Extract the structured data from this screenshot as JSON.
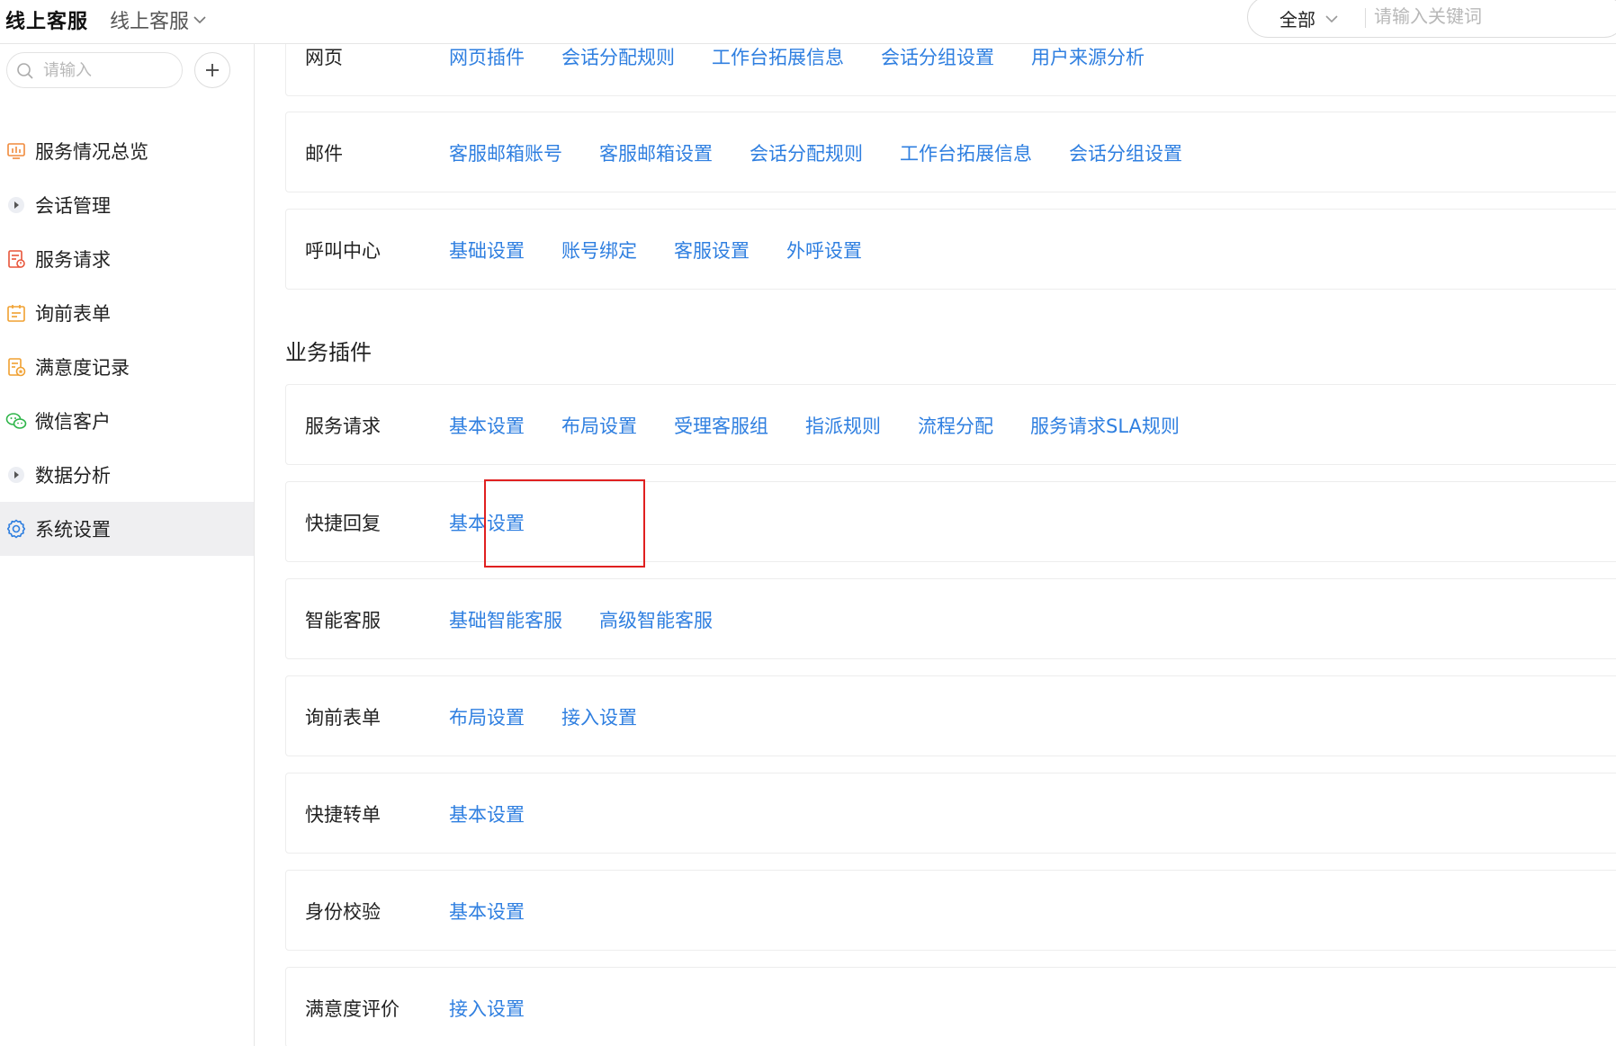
{
  "header": {
    "app_title": "线上客服",
    "app_switcher": "线上客服",
    "search_scope": "全部",
    "search_placeholder": "请输入关键词"
  },
  "sidebar": {
    "search_placeholder": "请输入",
    "items": [
      {
        "label": "服务情况总览",
        "icon": "monitor-chart-icon"
      },
      {
        "label": "会话管理",
        "icon": "caret-right-icon"
      },
      {
        "label": "服务请求",
        "icon": "ticket-icon"
      },
      {
        "label": "询前表单",
        "icon": "form-icon"
      },
      {
        "label": "满意度记录",
        "icon": "rating-record-icon"
      },
      {
        "label": "微信客户",
        "icon": "wechat-icon"
      },
      {
        "label": "数据分析",
        "icon": "caret-right-icon"
      },
      {
        "label": "系统设置",
        "icon": "gear-icon",
        "active": true
      }
    ]
  },
  "channel_rows": [
    {
      "title": "网页",
      "links": [
        "网页插件",
        "会话分配规则",
        "工作台拓展信息",
        "会话分组设置",
        "用户来源分析"
      ]
    },
    {
      "title": "邮件",
      "links": [
        "客服邮箱账号",
        "客服邮箱设置",
        "会话分配规则",
        "工作台拓展信息",
        "会话分组设置"
      ]
    },
    {
      "title": "呼叫中心",
      "links": [
        "基础设置",
        "账号绑定",
        "客服设置",
        "外呼设置"
      ]
    }
  ],
  "plugins_section_title": "业务插件",
  "plugin_rows": [
    {
      "title": "服务请求",
      "links": [
        "基本设置",
        "布局设置",
        "受理客服组",
        "指派规则",
        "流程分配",
        "服务请求SLA规则"
      ]
    },
    {
      "title": "快捷回复",
      "links": [
        "基本设置"
      ]
    },
    {
      "title": "智能客服",
      "links": [
        "基础智能客服",
        "高级智能客服"
      ]
    },
    {
      "title": "询前表单",
      "links": [
        "布局设置",
        "接入设置"
      ]
    },
    {
      "title": "快捷转单",
      "links": [
        "基本设置"
      ]
    },
    {
      "title": "身份校验",
      "links": [
        "基本设置"
      ]
    },
    {
      "title": "满意度评价",
      "links": [
        "接入设置"
      ]
    }
  ],
  "colors": {
    "link": "#2f7fe0",
    "highlight": "#e02020",
    "active_bg": "#efeff1"
  }
}
